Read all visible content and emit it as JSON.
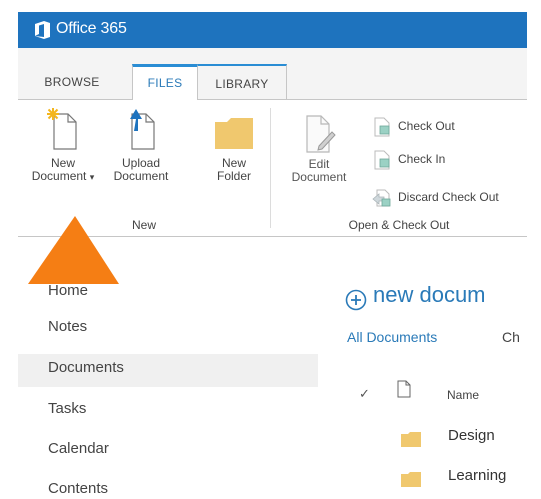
{
  "suite_bar": {
    "title": "Office 365"
  },
  "tabs": [
    {
      "label": "BROWSE"
    },
    {
      "label": "FILES"
    },
    {
      "label": "LIBRARY"
    }
  ],
  "ribbon": {
    "new_group": {
      "label": "New",
      "new_document": {
        "line1": "New",
        "line2": "Document"
      },
      "upload_document": {
        "line1": "Upload",
        "line2": "Document"
      },
      "new_folder": {
        "line1": "New",
        "line2": "Folder"
      }
    },
    "open_checkout_group": {
      "label": "Open & Check Out",
      "edit_document": {
        "line1": "Edit",
        "line2": "Document"
      },
      "check_out": "Check Out",
      "check_in": "Check In",
      "discard_check_out": "Discard Check Out"
    }
  },
  "left_nav": {
    "items": [
      {
        "label": "Home"
      },
      {
        "label": "Notes"
      },
      {
        "label": "Documents",
        "selected": true
      },
      {
        "label": "Tasks"
      },
      {
        "label": "Calendar"
      },
      {
        "label": "Contents"
      }
    ]
  },
  "main": {
    "new_document_link": "new docum",
    "views": {
      "all_documents": "All Documents",
      "other": "Ch"
    },
    "list": {
      "checkmark": "✓",
      "name_header": "Name",
      "items": [
        {
          "name": "Design"
        },
        {
          "name": "Learning"
        }
      ]
    }
  },
  "colors": {
    "suite_bar": "#1e73be",
    "accent": "#2a7ab8",
    "folder": "#f0c86e",
    "callout_arrow": "#f57e14"
  }
}
